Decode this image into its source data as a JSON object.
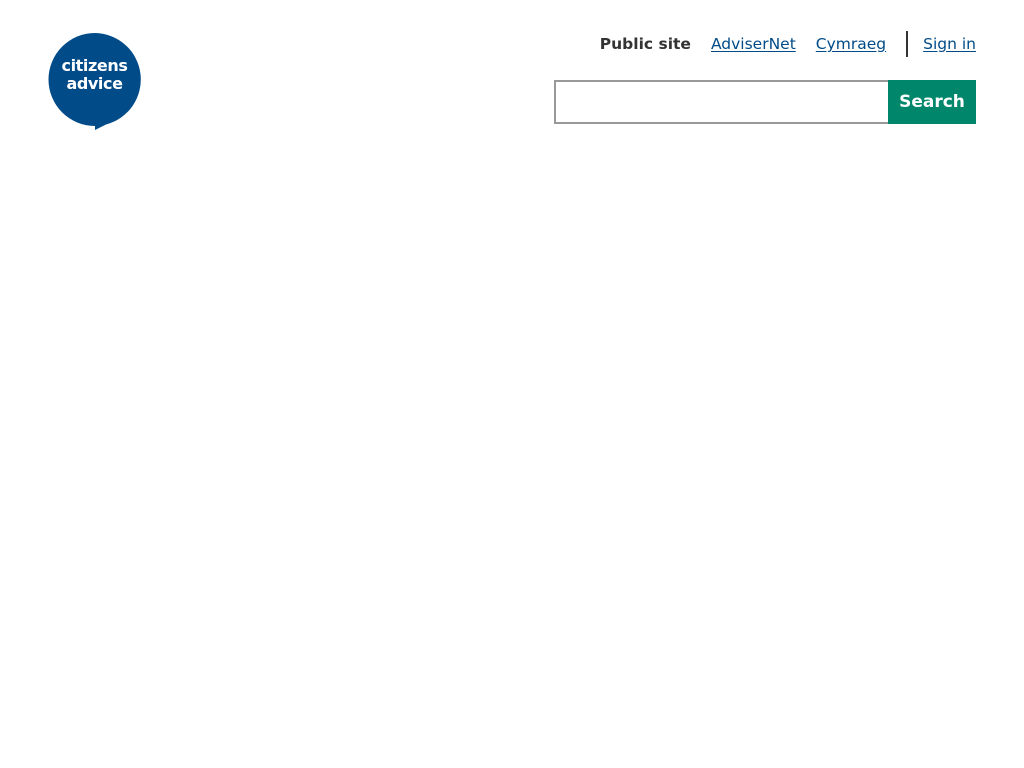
{
  "logo": {
    "line1": "citizens",
    "line2": "advice",
    "color": "#004b88"
  },
  "topnav": {
    "current_site": "Public site",
    "links": [
      {
        "label": "AdviserNet"
      },
      {
        "label": "Cymraeg"
      }
    ],
    "sign_in": "Sign in"
  },
  "search": {
    "value": "",
    "placeholder": "",
    "button_label": "Search",
    "button_color": "#00866b"
  }
}
